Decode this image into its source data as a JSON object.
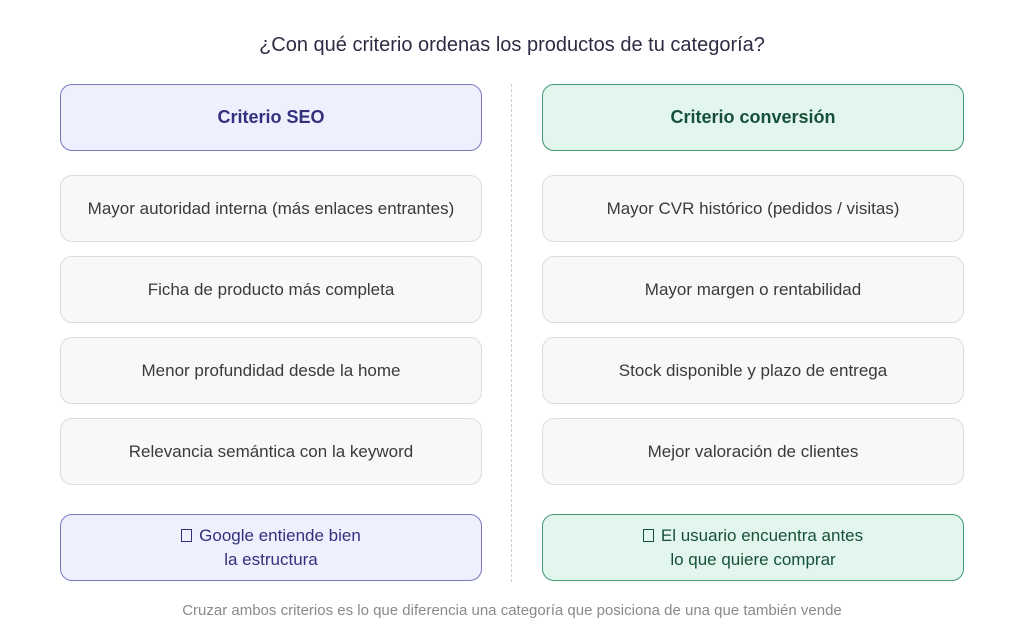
{
  "title": "¿Con qué criterio ordenas los productos de tu categoría?",
  "seo": {
    "header": "Criterio SEO",
    "items": [
      "Mayor autoridad interna (más enlaces entrantes)",
      "Ficha de producto más completa",
      "Menor profundidad desde la home",
      "Relevancia semántica con la keyword"
    ],
    "result_line1": "Google entiende bien",
    "result_line2": "la estructura",
    "result_icon": "check-box-icon"
  },
  "conversion": {
    "header": "Criterio conversión",
    "items": [
      "Mayor CVR histórico (pedidos / visitas)",
      "Mayor margen o rentabilidad",
      "Stock disponible y plazo de entrega",
      "Mejor valoración de clientes"
    ],
    "result_line1": "El usuario encuentra antes",
    "result_line2": "lo que quiere comprar",
    "result_icon": "check-box-icon"
  },
  "caption": "Cruzar ambos criterios es lo que diferencia una categoría que posiciona de una que también vende",
  "colors": {
    "seo_accent": "#33307e",
    "seo_fill": "#eef0fd",
    "conversion_accent": "#17503a",
    "conversion_fill": "#e3f6ee"
  }
}
